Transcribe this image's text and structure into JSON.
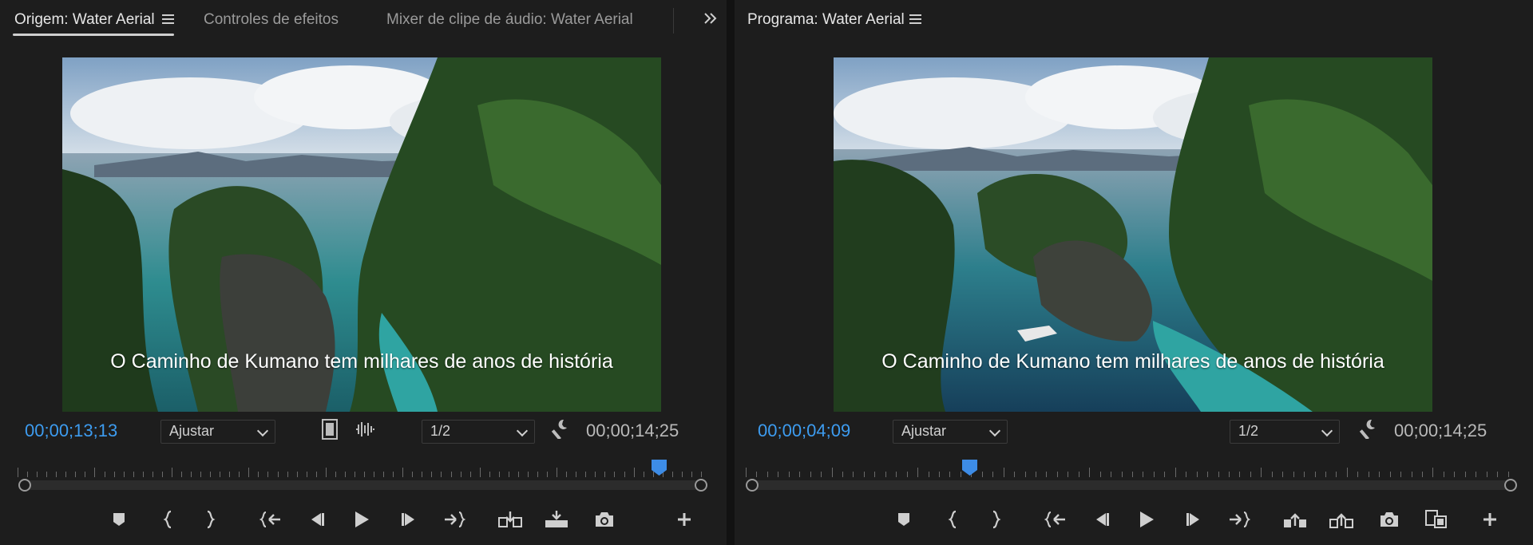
{
  "source": {
    "tabs": [
      {
        "label": "Origem: Water Aerial"
      },
      {
        "label": "Controles de efeitos"
      },
      {
        "label": "Mixer de clipe de áudio: Water Aerial"
      }
    ],
    "caption": "O Caminho de Kumano tem milhares de anos de história",
    "current_timecode": "00;00;13;13",
    "fit_select": "Ajustar",
    "resolution_select": "1/2",
    "duration_timecode": "00;00;14;25",
    "playhead_position": 0.936
  },
  "program": {
    "title": "Programa: Water Aerial",
    "caption": "O Caminho de Kumano tem milhares de anos de história",
    "current_timecode": "00;00;04;09",
    "fit_select": "Ajustar",
    "resolution_select": "1/2",
    "duration_timecode": "00;00;14;25",
    "playhead_position": 0.288
  },
  "colors": {
    "timecode_accent": "#3d9cf0",
    "playhead": "#3d8ce6"
  }
}
